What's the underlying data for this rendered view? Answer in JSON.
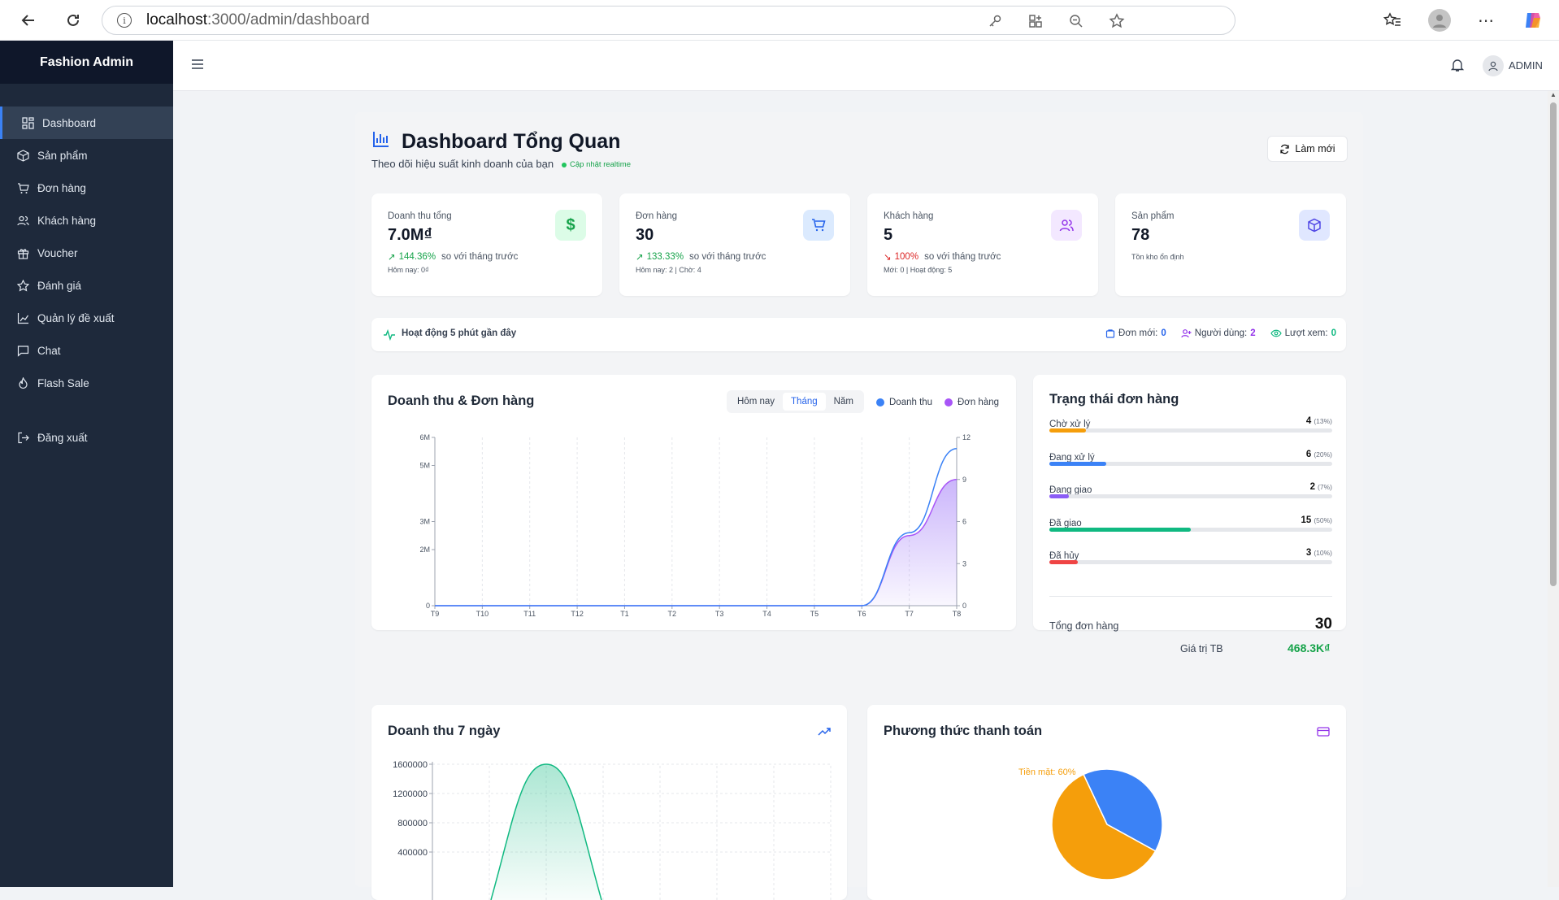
{
  "browser": {
    "url_host": "localhost",
    "url_path": ":3000/admin/dashboard"
  },
  "sidebar": {
    "brand": "Fashion Admin",
    "items": [
      {
        "label": "Dashboard",
        "icon": "grid-icon",
        "active": true
      },
      {
        "label": "Sản phẩm",
        "icon": "box-icon"
      },
      {
        "label": "Đơn hàng",
        "icon": "cart-icon"
      },
      {
        "label": "Khách hàng",
        "icon": "users-icon"
      },
      {
        "label": "Voucher",
        "icon": "gift-icon"
      },
      {
        "label": "Đánh giá",
        "icon": "star-icon"
      },
      {
        "label": "Quản lý đề xuất",
        "icon": "chart-icon"
      },
      {
        "label": "Chat",
        "icon": "chat-icon"
      },
      {
        "label": "Flash Sale",
        "icon": "flame-icon"
      }
    ],
    "logout": "Đăng xuất"
  },
  "topbar": {
    "user": "ADMIN"
  },
  "header": {
    "title": "Dashboard Tổng Quan",
    "subtitle": "Theo dõi hiệu suất kinh doanh của bạn",
    "realtime": "Cập nhật realtime",
    "refresh_label": "Làm mới"
  },
  "stats": [
    {
      "label": "Doanh thu tổng",
      "value": "7.0M₫",
      "change": "144.36%",
      "change_text": "so với tháng trước",
      "note": "Hôm nay: 0₫",
      "trend": "up",
      "color": "#16a34a"
    },
    {
      "label": "Đơn hàng",
      "value": "30",
      "change": "133.33%",
      "change_text": "so với tháng trước",
      "note": "Hôm nay: 2 | Chờ: 4",
      "trend": "up",
      "color": "#2563eb"
    },
    {
      "label": "Khách hàng",
      "value": "5",
      "change": "100%",
      "change_text": "so với tháng trước",
      "note": "Mới: 0 | Hoạt động: 5",
      "trend": "down",
      "color": "#9333ea"
    },
    {
      "label": "Sản phẩm",
      "value": "78",
      "note": "Tồn kho ổn định",
      "color": "#4f46e5"
    }
  ],
  "activity": {
    "title": "Hoạt động 5 phút gần đây",
    "new_orders_label": "Đơn mới:",
    "new_orders": "0",
    "users_label": "Người dùng:",
    "users": "2",
    "views_label": "Lượt xem:",
    "views": "0"
  },
  "revenue_chart": {
    "title": "Doanh thu & Đơn hàng",
    "tabs": [
      "Hôm nay",
      "Tháng",
      "Năm"
    ],
    "active_tab": "Tháng",
    "legend": [
      "Doanh thu",
      "Đơn hàng"
    ]
  },
  "order_status": {
    "title": "Trạng thái đơn hàng",
    "items": [
      {
        "label": "Chờ xử lý",
        "count": "4",
        "pct": "(13%)",
        "value": 0.13,
        "color": "#f59e0b"
      },
      {
        "label": "Đang xử lý",
        "count": "6",
        "pct": "(20%)",
        "value": 0.2,
        "color": "#3b82f6"
      },
      {
        "label": "Đang giao",
        "count": "2",
        "pct": "(7%)",
        "value": 0.07,
        "color": "#8b5cf6"
      },
      {
        "label": "Đã giao",
        "count": "15",
        "pct": "(50%)",
        "value": 0.5,
        "color": "#10b981"
      },
      {
        "label": "Đã hủy",
        "count": "3",
        "pct": "(10%)",
        "value": 0.1,
        "color": "#ef4444"
      }
    ],
    "total_label": "Tổng đơn hàng",
    "total": "30",
    "avg_label": "Giá trị TB",
    "avg": "468.3K₫"
  },
  "week_chart": {
    "title": "Doanh thu 7 ngày"
  },
  "payment": {
    "title": "Phương thức thanh toán",
    "cash_label": "Tiền mặt: 60%"
  },
  "chart_data": [
    {
      "type": "area",
      "title": "Doanh thu & Đơn hàng",
      "categories": [
        "T9",
        "T10",
        "T11",
        "T12",
        "T1",
        "T2",
        "T3",
        "T4",
        "T5",
        "T6",
        "T7",
        "T8"
      ],
      "series": [
        {
          "name": "Doanh thu",
          "axis": "left",
          "values": [
            0,
            0,
            0,
            0,
            0,
            0,
            0,
            0,
            0,
            0,
            2600000,
            5600000
          ]
        },
        {
          "name": "Đơn hàng",
          "axis": "right",
          "values": [
            0,
            0,
            0,
            0,
            0,
            0,
            0,
            0,
            0,
            0,
            5,
            9
          ]
        }
      ],
      "y_left_ticks": [
        "0",
        "2M",
        "3M",
        "5M",
        "6M"
      ],
      "y_left_values": [
        0,
        2000000,
        3000000,
        5000000,
        6000000
      ],
      "y_left_lim": [
        0,
        6000000
      ],
      "y_right_ticks": [
        "0",
        "3",
        "6",
        "9",
        "12"
      ],
      "y_right_values": [
        0,
        3,
        6,
        9,
        12
      ],
      "y_right_lim": [
        0,
        12
      ]
    },
    {
      "type": "area",
      "title": "Doanh thu 7 ngày",
      "y_ticks": [
        "1600000",
        "1200000",
        "800000",
        "400000"
      ],
      "y_tick_values": [
        1600000,
        1200000,
        800000,
        400000
      ],
      "peak": 1600000
    },
    {
      "type": "pie",
      "title": "Phương thức thanh toán",
      "slices": [
        {
          "name": "Tiền mặt",
          "value": 60,
          "color": "#f59e0b"
        },
        {
          "value": 40,
          "color": "#3b82f6"
        }
      ]
    }
  ]
}
